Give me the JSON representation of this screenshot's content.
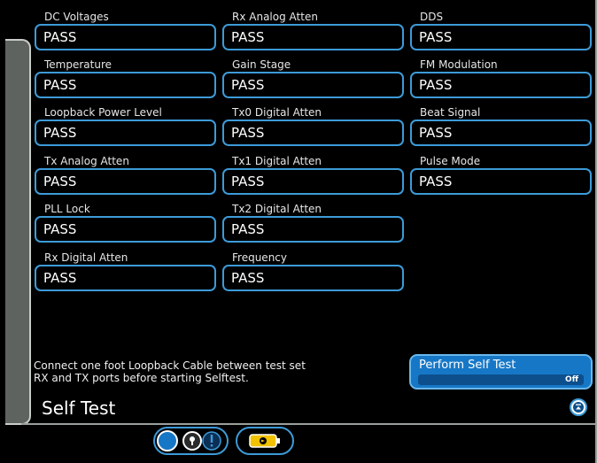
{
  "tests": [
    {
      "label": "DC Voltages",
      "value": "PASS"
    },
    {
      "label": "Temperature",
      "value": "PASS"
    },
    {
      "label": "Loopback Power Level",
      "value": "PASS"
    },
    {
      "label": "Tx Analog Atten",
      "value": "PASS"
    },
    {
      "label": "PLL Lock",
      "value": "PASS"
    },
    {
      "label": "Rx Digital Atten",
      "value": "PASS"
    },
    {
      "label": "Rx Analog Atten",
      "value": "PASS"
    },
    {
      "label": "Gain Stage",
      "value": "PASS"
    },
    {
      "label": "Tx0 Digital Atten",
      "value": "PASS"
    },
    {
      "label": "Tx1 Digital Atten",
      "value": "PASS"
    },
    {
      "label": "Tx2 Digital Atten",
      "value": "PASS"
    },
    {
      "label": "Frequency",
      "value": "PASS"
    },
    {
      "label": "DDS",
      "value": "PASS"
    },
    {
      "label": "FM Modulation",
      "value": "PASS"
    },
    {
      "label": "Beat Signal",
      "value": "PASS"
    },
    {
      "label": "Pulse Mode",
      "value": "PASS"
    }
  ],
  "note": {
    "line1": "Connect one foot Loopback Cable between test set",
    "line2": "RX and TX ports before starting Selftest."
  },
  "page_title": "Self Test",
  "perform_button": {
    "label": "Perform Self Test",
    "state": "Off"
  },
  "colors": {
    "accent": "#3d9bd8",
    "button": "#1677c6",
    "panel": "#5f6360"
  },
  "icons": {
    "collapse": "chevron-up-icon",
    "mode_left": "circle-icon",
    "mode_middle": "key-icon",
    "mode_right": "alert-icon",
    "battery": "battery-icon"
  }
}
